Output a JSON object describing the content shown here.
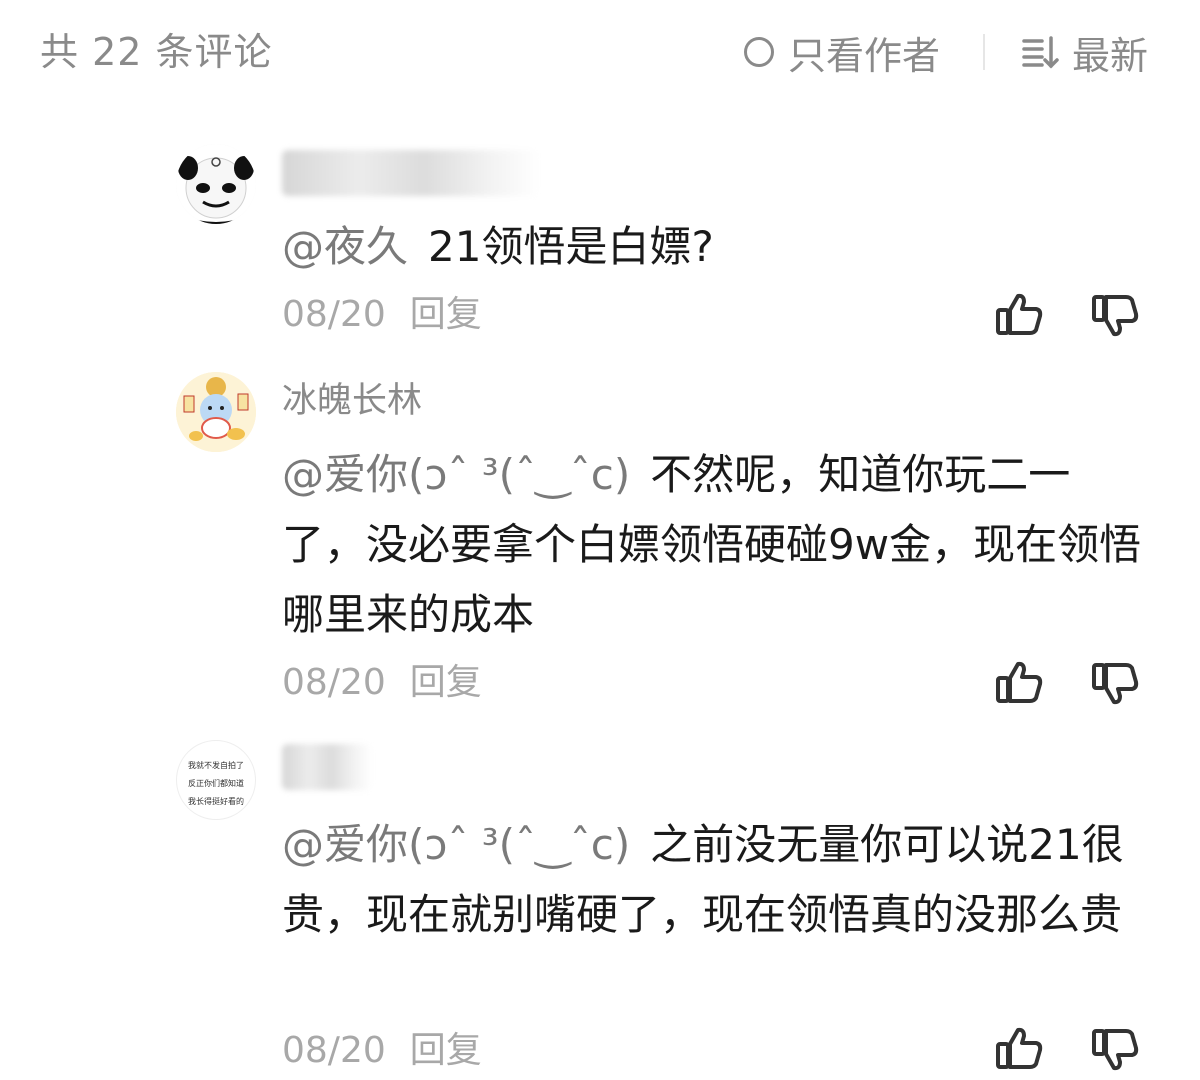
{
  "header": {
    "comment_count_label": "共 22 条评论",
    "author_only_label": "只看作者",
    "sort_label": "最新"
  },
  "comments": [
    {
      "username": "",
      "username_blurred": true,
      "mention": "@夜久",
      "text": "21领悟是白嫖?",
      "date": "08/20",
      "reply_label": "回复",
      "avatar_icon": "panda-meme-avatar-icon"
    },
    {
      "username": "冰魄长林",
      "username_blurred": false,
      "mention": "@爱你(ↄˆ ³(ˆ‿ˆc)",
      "text": "不然呢，知道你玩二一了，没必要拿个白嫖领悟硬碰9w金，现在领悟哪里来的成本",
      "date": "08/20",
      "reply_label": "回复",
      "avatar_icon": "cartoon-fortune-avatar-icon"
    },
    {
      "username": "",
      "username_blurred": true,
      "mention": "@爱你(ↄˆ ³(ˆ‿ˆc)",
      "text": "之前没无量你可以说21很贵，现在就别嘴硬了，现在领悟真的没那么贵",
      "date": "08/20",
      "reply_label": "回复",
      "avatar_icon": "text-avatar-icon",
      "avatar_text": [
        "我就不发自拍了",
        "反正你们都知道",
        "我长得挺好看的"
      ]
    }
  ],
  "colors": {
    "secondary_text": "#8a8a8a",
    "primary_text": "#1a1a1a",
    "meta_text": "#a8a8a8",
    "icon_stroke": "#333333"
  }
}
